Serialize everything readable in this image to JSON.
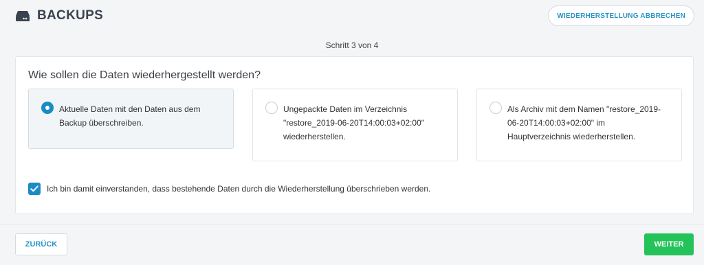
{
  "header": {
    "title": "BACKUPS",
    "icon": "drive-icon",
    "abort_label": "WIEDERHERSTELLUNG ABBRECHEN"
  },
  "step": {
    "label": "Schritt 3 von 4"
  },
  "question": "Wie sollen die Daten wiederhergestellt werden?",
  "options": [
    {
      "text": "Aktuelle Daten mit den Daten aus dem Backup überschreiben.",
      "selected": true
    },
    {
      "text": "Ungepackte Daten im Verzeichnis \"restore_2019-06-20T14:00:03+02:00\" wiederherstellen.",
      "selected": false
    },
    {
      "text": "Als Archiv mit dem Namen \"restore_2019-06-20T14:00:03+02:00\" im Hauptverzeichnis wiederherstellen.",
      "selected": false
    }
  ],
  "consent": {
    "checked": true,
    "text": "Ich bin damit einverstanden, dass bestehende Daten durch die Wiederherstellung überschrieben werden."
  },
  "footer": {
    "back_label": "ZURÜCK",
    "next_label": "WEITER"
  },
  "colors": {
    "accent": "#1a8bc3",
    "link": "#2a95c4",
    "success": "#24c35a",
    "background": "#f4f5f7"
  }
}
